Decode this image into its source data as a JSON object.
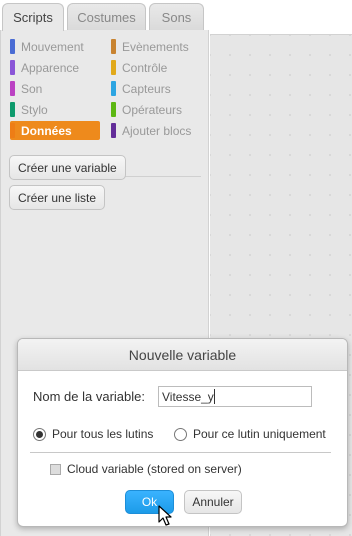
{
  "tabs": [
    {
      "label": "Scripts",
      "active": true
    },
    {
      "label": "Costumes",
      "active": false
    },
    {
      "label": "Sons",
      "active": false
    }
  ],
  "categories": [
    {
      "label": "Mouvement",
      "color": "#4a6cd4",
      "selected": false
    },
    {
      "label": "Apparence",
      "color": "#8a55d7",
      "selected": false
    },
    {
      "label": "Son",
      "color": "#bb42c3",
      "selected": false
    },
    {
      "label": "Stylo",
      "color": "#0e9a6c",
      "selected": false
    },
    {
      "label": "Données",
      "color": "#ee7d16",
      "selected": true
    },
    {
      "label": "Evènements",
      "color": "#c88330",
      "selected": false
    },
    {
      "label": "Contrôle",
      "color": "#e1a91a",
      "selected": false
    },
    {
      "label": "Capteurs",
      "color": "#2ca5e2",
      "selected": false
    },
    {
      "label": "Opérateurs",
      "color": "#5cb712",
      "selected": false
    },
    {
      "label": "Ajouter blocs",
      "color": "#632d99",
      "selected": false
    }
  ],
  "palette_buttons": {
    "create_variable": "Créer une variable",
    "create_list": "Créer une liste"
  },
  "dialog": {
    "title": "Nouvelle variable",
    "name_label": "Nom de la variable:",
    "name_value": "Vitesse_y",
    "radio_all": "Pour tous les lutins",
    "radio_all_checked": true,
    "radio_this": "Pour ce lutin uniquement",
    "radio_this_checked": false,
    "cloud_label": "Cloud variable (stored on server)",
    "cloud_checked": false,
    "ok_label": "Ok",
    "cancel_label": "Annuler"
  },
  "colors": {
    "selected_category_bg": "#ee8a1c",
    "ok_button": "#1c9be8",
    "palette_bg": "#e9e9e9"
  }
}
